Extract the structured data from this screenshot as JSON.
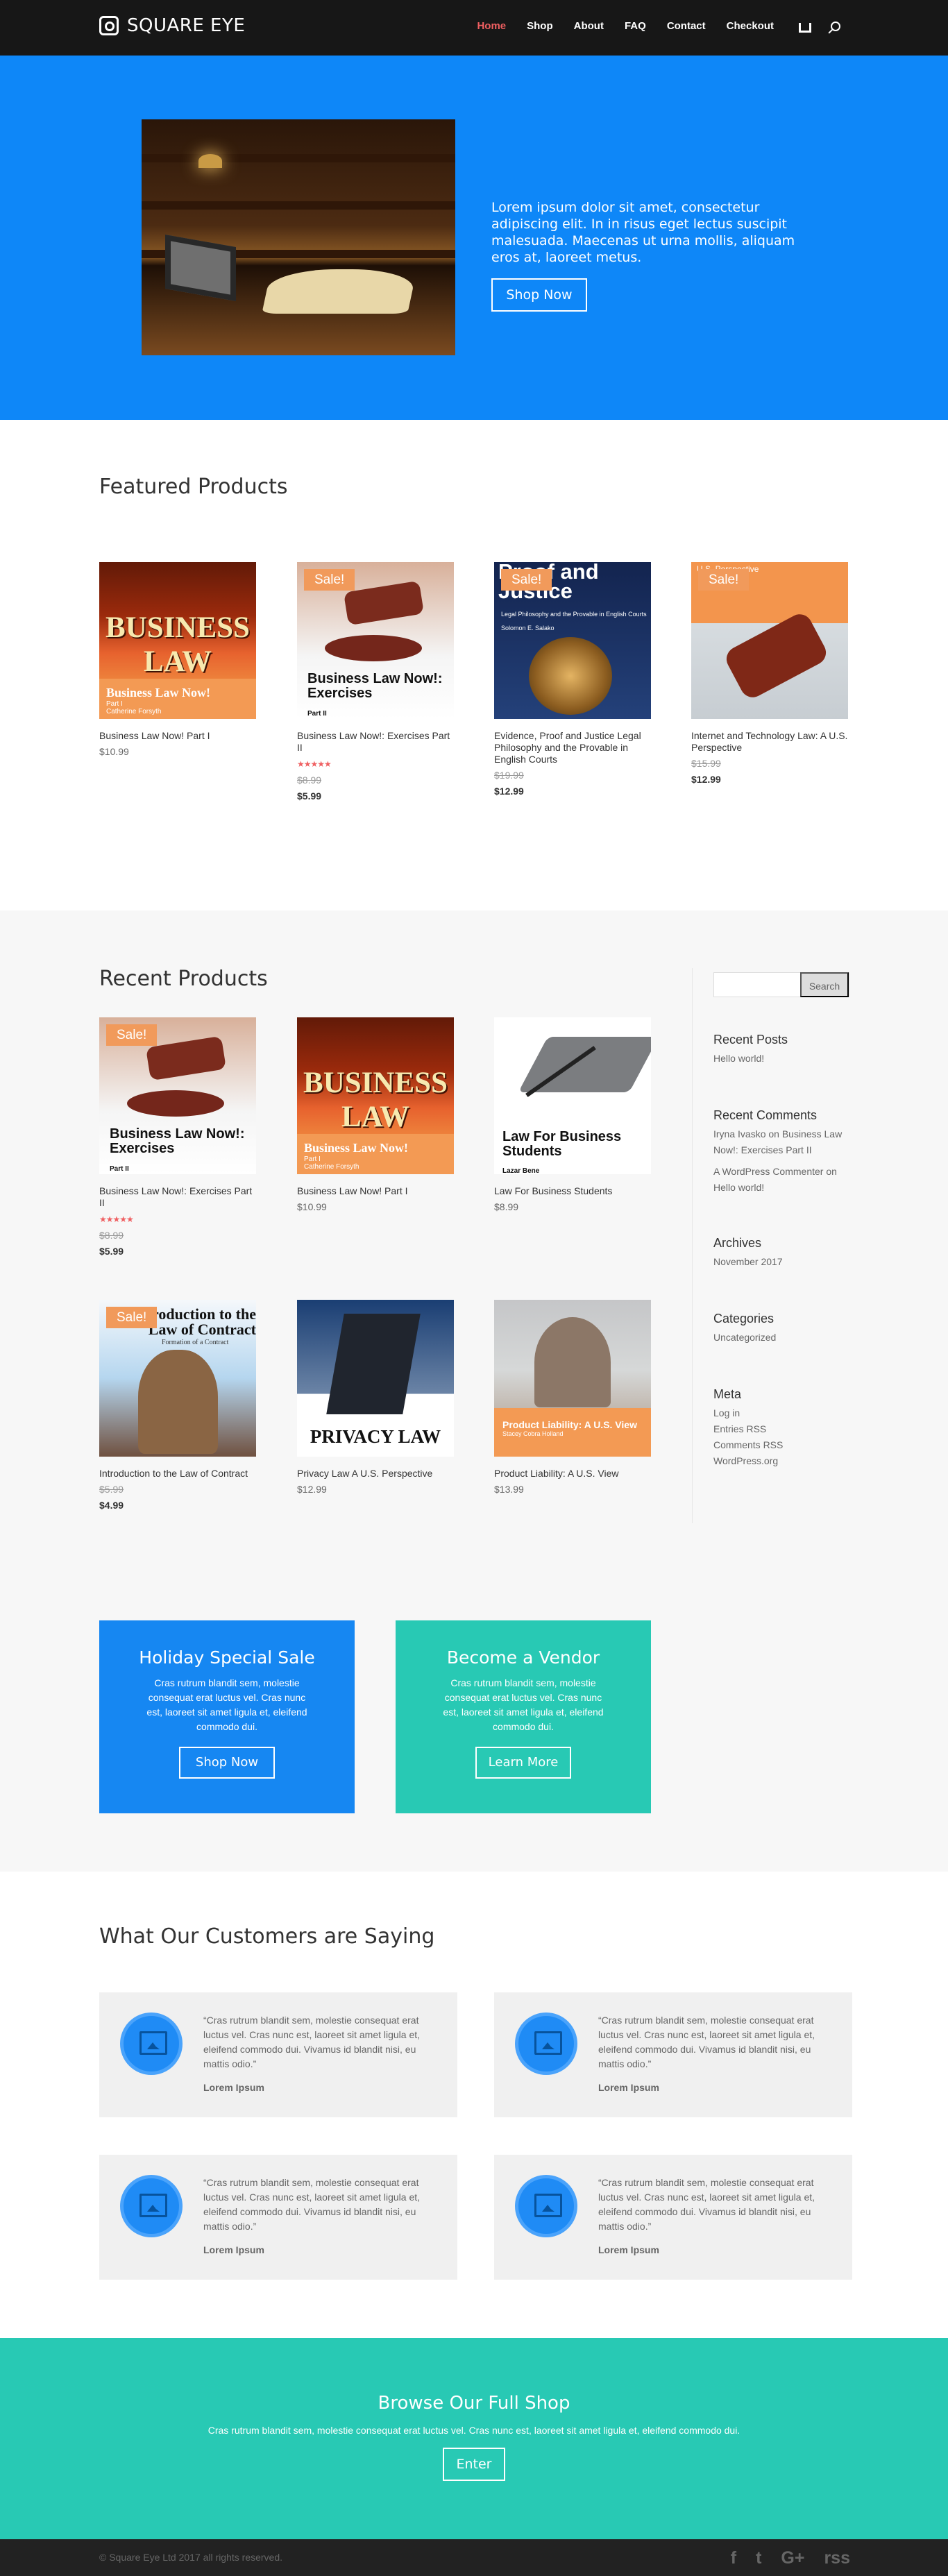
{
  "header": {
    "logo": "SQUARE EYE",
    "nav": [
      "Home",
      "Shop",
      "About",
      "FAQ",
      "Contact",
      "Checkout"
    ]
  },
  "hero": {
    "text": "Lorem ipsum dolor sit amet, consectetur adipiscing elit. In in risus eget lectus suscipit malesuada. Maecenas ut urna mollis, aliquam eros at, laoreet metus.",
    "button": "Shop Now"
  },
  "featured": {
    "title": "Featured Products",
    "products": [
      {
        "name": "Business Law Now! Part I",
        "price": "$10.99"
      },
      {
        "name": "Business Law Now!: Exercises Part II",
        "old": "$8.99",
        "price": "$5.99",
        "sale": "Sale!"
      },
      {
        "name": "Evidence, Proof and Justice Legal Philosophy and the Provable in English Courts",
        "old": "$19.99",
        "price": "$12.99",
        "sale": "Sale!"
      },
      {
        "name": "Internet and Technology Law: A U.S. Perspective",
        "old": "$15.99",
        "price": "$12.99",
        "sale": "Sale!"
      }
    ]
  },
  "recent": {
    "title": "Recent Products",
    "products": [
      {
        "name": "Business Law Now!: Exercises Part II",
        "old": "$8.99",
        "price": "$5.99",
        "sale": "Sale!"
      },
      {
        "name": "Business Law Now! Part I",
        "price": "$10.99"
      },
      {
        "name": "Law For Business Students",
        "price": "$8.99"
      },
      {
        "name": "Introduction to the Law of Contract",
        "old": "$5.99",
        "price": "$4.99",
        "sale": "Sale!"
      },
      {
        "name": "Privacy Law A U.S. Perspective",
        "price": "$12.99"
      },
      {
        "name": "Product Liability: A U.S. View",
        "price": "$13.99"
      }
    ]
  },
  "book_covers": {
    "business_law": {
      "title": "BUSINESS LAW",
      "subtitle": "Business Law Now!",
      "part": "Part I",
      "author": "Catherine Forsyth"
    },
    "exercises": {
      "title": "Business Law Now!: Exercises",
      "part": "Part II"
    },
    "proof": {
      "title": "Proof and Justice",
      "subtitle": "Legal Philosophy and the Provable in English Courts",
      "author": "Solomon E. Salako"
    },
    "internet": {
      "title": "U.S. Perspective"
    },
    "students": {
      "title": "Law For Business Students",
      "author": "Lazar Bene"
    },
    "contract": {
      "title": "Introduction to the Law of Contract",
      "subtitle": "Formation of a Contract"
    },
    "privacy": {
      "title": "PRIVACY LAW",
      "subtitle": "A U.S. Perspective"
    },
    "liability": {
      "title": "Product Liability: A U.S. View",
      "author": "Stacey Cobra Holland"
    }
  },
  "sidebar": {
    "search_button": "Search",
    "recent_posts_title": "Recent Posts",
    "recent_post": "Hello world!",
    "comments_title": "Recent Comments",
    "comment1": "Iryna Ivasko on Business Law Now!: Exercises Part II",
    "comment2": "A WordPress Commenter on Hello world!",
    "archives_title": "Archives",
    "archive": "November 2017",
    "categories_title": "Categories",
    "category": "Uncategorized",
    "meta_title": "Meta",
    "meta": [
      "Log in",
      "Entries RSS",
      "Comments RSS",
      "WordPress.org"
    ]
  },
  "promos": [
    {
      "title": "Holiday Special Sale",
      "text": "Cras rutrum blandit sem, molestie consequat erat luctus vel. Cras nunc est, laoreet sit amet ligula et, eleifend commodo dui.",
      "button": "Shop Now"
    },
    {
      "title": "Become a Vendor",
      "text": "Cras rutrum blandit sem, molestie consequat erat luctus vel. Cras nunc est, laoreet sit amet ligula et, eleifend commodo dui.",
      "button": "Learn More"
    }
  ],
  "testimonials": {
    "title": "What Our Customers are Saying",
    "quote": "“Cras rutrum blandit sem, molestie consequat erat luctus vel. Cras nunc est, laoreet sit amet ligula et, eleifend commodo dui. Vivamus id blandit nisi, eu mattis odio.”",
    "name": "Lorem Ipsum"
  },
  "browse": {
    "title": "Browse Our Full Shop",
    "text": "Cras rutrum blandit sem, molestie consequat erat luctus vel. Cras nunc est, laoreet sit amet ligula et, eleifend commodo dui.",
    "button": "Enter"
  },
  "footer": {
    "copyright": "© Square Eye Ltd 2017 all rights reserved.",
    "social": [
      "f",
      "t",
      "G+",
      "rss"
    ]
  },
  "colors": {
    "hero": "#0e87f8",
    "accent": "#ef5f61",
    "teal": "#28c9b4",
    "orange": "#f19a5b"
  }
}
